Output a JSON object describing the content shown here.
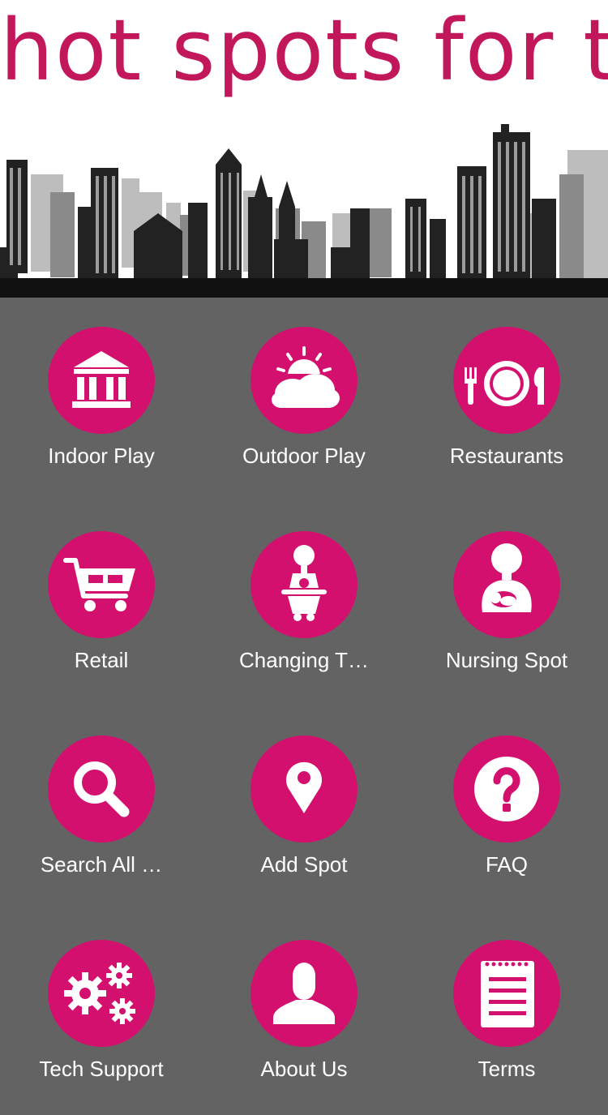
{
  "header": {
    "logo_text": "hot spots for tots"
  },
  "colors": {
    "background": "#636363",
    "accent": "#d4106f",
    "logo": "#c2185b"
  },
  "menu": [
    {
      "label": "Indoor Play",
      "icon": "museum-building-icon"
    },
    {
      "label": "Outdoor Play",
      "icon": "sun-cloud-icon"
    },
    {
      "label": "Restaurants",
      "icon": "plate-cutlery-icon"
    },
    {
      "label": "Retail",
      "icon": "shopping-cart-icon"
    },
    {
      "label": "Changing T…",
      "icon": "changing-table-icon"
    },
    {
      "label": "Nursing Spot",
      "icon": "nursing-mother-icon"
    },
    {
      "label": "Search All …",
      "icon": "search-icon"
    },
    {
      "label": "Add Spot",
      "icon": "map-pin-icon"
    },
    {
      "label": "FAQ",
      "icon": "question-icon"
    },
    {
      "label": "Tech Support",
      "icon": "gears-icon"
    },
    {
      "label": "About Us",
      "icon": "person-icon"
    },
    {
      "label": "Terms",
      "icon": "notepad-icon"
    }
  ]
}
